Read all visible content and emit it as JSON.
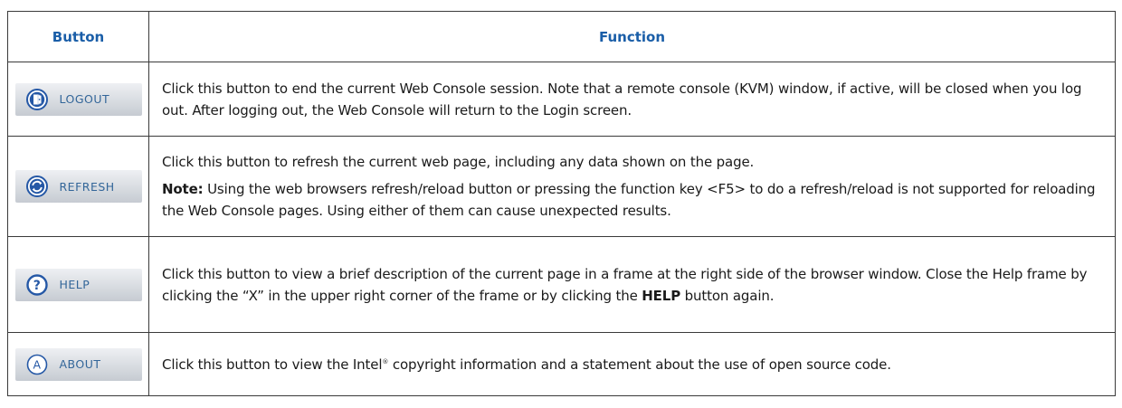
{
  "colors": {
    "header_text": "#1a5ea8",
    "button_label": "#336699",
    "icon_blue": "#2558a6"
  },
  "table": {
    "headers": {
      "button": "Button",
      "function": "Function"
    },
    "rows": [
      {
        "button": {
          "label": "LOGOUT",
          "icon": "logout-door-icon"
        },
        "function": {
          "text": "Click this button to end the current Web Console session. Note that a remote console (KVM) window, if active, will be closed when you log out. After logging out, the Web Console will return to the Login screen."
        }
      },
      {
        "button": {
          "label": "REFRESH",
          "icon": "refresh-icon"
        },
        "function": {
          "text": "Click this button to refresh the current web page, including any data shown on the page.",
          "note_label": "Note:",
          "note_text": " Using the web browsers refresh/reload button or pressing the function key <F5> to do a refresh/reload is not supported for reloading the Web Console pages. Using either of them can cause unexpected results."
        }
      },
      {
        "button": {
          "label": "HELP",
          "icon": "help-question-icon"
        },
        "function": {
          "text_before": "Click this button to view a brief description of the current page in a frame at the right side of the browser window. Close the Help frame by clicking the “X” in the upper right corner of the frame or by clicking the ",
          "bold": "HELP",
          "text_after": " button again."
        }
      },
      {
        "button": {
          "label": "ABOUT",
          "icon": "about-a-icon"
        },
        "function": {
          "text_before": "Click this button to view the Intel",
          "superscript": "®",
          "text_after": " copyright information and a statement about the use of open source code."
        }
      }
    ]
  }
}
